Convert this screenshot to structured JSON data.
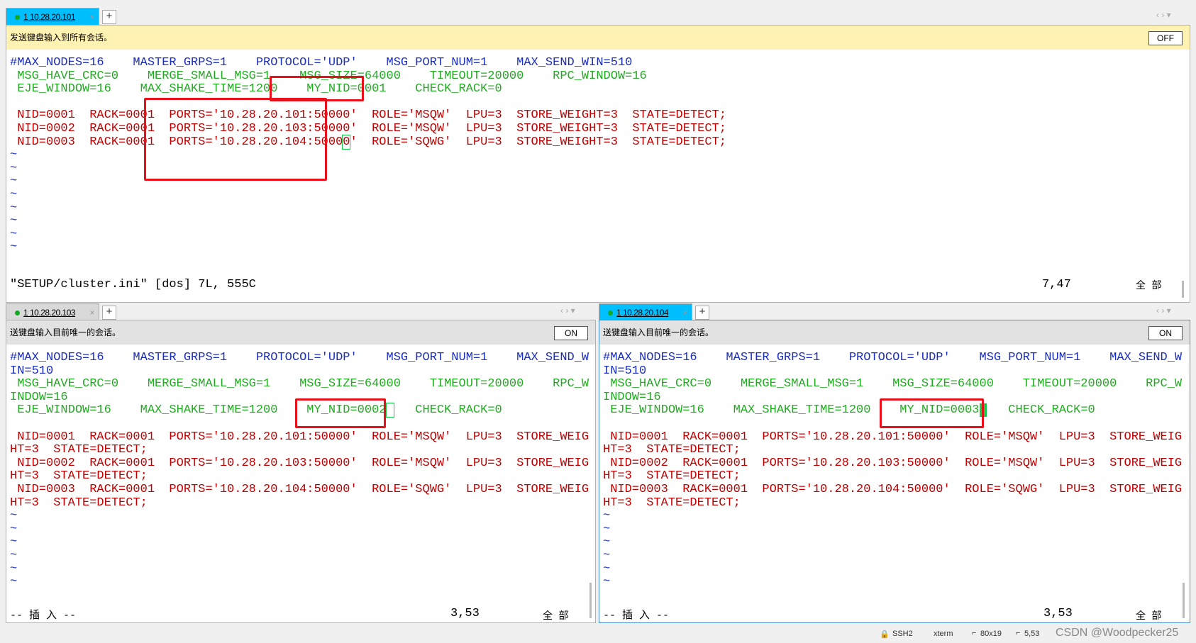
{
  "top": {
    "tab": {
      "label": "1 10.28.20.101"
    },
    "banner": {
      "text": "发送键盘输入到所有会话。",
      "button": "OFF"
    },
    "lines": [
      [
        [
          "b",
          "#MAX_NODES=16    MASTER_GRPS=1    PROTOCOL='UDP'    MSG_PORT_NUM=1    MAX_SEND_WIN=510"
        ]
      ],
      [
        [
          "g",
          " MSG_HAVE_CRC=0    MERGE_SMALL_MSG=1    MSG_SIZE=64000    TIMEOUT=20000    RPC_WINDOW=16"
        ]
      ],
      [
        [
          "g",
          " EJE_WINDOW=16    MAX_SHAKE_TIME=1200    MY_NID=0001    CHECK_RACK=0"
        ]
      ],
      [
        [
          "g",
          ""
        ]
      ],
      [
        [
          "r",
          " NID=0001  RACK=0001  PORTS='10.28.20.101:50000'  ROLE='MSQW'  LPU=3  STORE_WEIGHT=3  STATE=DETECT;"
        ]
      ],
      [
        [
          "r",
          " NID=0002  RACK=0001  PORTS='10.28.20.103:50000'  ROLE='MSQW'  LPU=3  STORE_WEIGHT=3  STATE=DETECT;"
        ]
      ],
      [
        [
          "r",
          " NID=0003  RACK=0001  PORTS='10.28.20.104:5000"
        ],
        [
          "curo",
          "0"
        ],
        [
          "r",
          "'  ROLE='SQWG'  LPU=3  STORE_WEIGHT=3  STATE=DETECT;"
        ]
      ],
      [
        [
          "t",
          "~"
        ]
      ],
      [
        [
          "t",
          "~"
        ]
      ],
      [
        [
          "t",
          "~"
        ]
      ],
      [
        [
          "t",
          "~"
        ]
      ],
      [
        [
          "t",
          "~"
        ]
      ],
      [
        [
          "t",
          "~"
        ]
      ],
      [
        [
          "t",
          "~"
        ]
      ],
      [
        [
          "t",
          "~"
        ]
      ]
    ],
    "status_left": "\"SETUP/cluster.ini\" [dos] 7L, 555C",
    "status_pos": "7,47",
    "status_all": "全 部"
  },
  "left": {
    "tab": {
      "label": "1 10.28.20.103"
    },
    "banner": {
      "text": "送键盘输入目前唯一的会话。",
      "button": "ON"
    },
    "lines": [
      [
        [
          "b",
          "#MAX_NODES=16    MASTER_GRPS=1    PROTOCOL='UDP'    MSG_PORT_NUM=1    MAX_SEND_W"
        ]
      ],
      [
        [
          "b",
          "IN=510"
        ]
      ],
      [
        [
          "g",
          " MSG_HAVE_CRC=0    MERGE_SMALL_MSG=1    MSG_SIZE=64000    TIMEOUT=20000    RPC_W"
        ]
      ],
      [
        [
          "g",
          "INDOW=16"
        ]
      ],
      [
        [
          "g",
          " EJE_WINDOW=16    MAX_SHAKE_TIME=1200    MY_NID=0002"
        ],
        [
          "curo",
          " "
        ],
        [
          "g",
          "   CHECK_RACK=0"
        ]
      ],
      [
        [
          "g",
          ""
        ]
      ],
      [
        [
          "r",
          " NID=0001  RACK=0001  PORTS='10.28.20.101:50000'  ROLE='MSQW'  LPU=3  STORE_WEIG"
        ]
      ],
      [
        [
          "r",
          "HT=3  STATE=DETECT;"
        ]
      ],
      [
        [
          "r",
          " NID=0002  RACK=0001  PORTS='10.28.20.103:50000'  ROLE='MSQW'  LPU=3  STORE_WEIG"
        ]
      ],
      [
        [
          "r",
          "HT=3  STATE=DETECT;"
        ]
      ],
      [
        [
          "r",
          " NID=0003  RACK=0001  PORTS='10.28.20.104:50000'  ROLE='SQWG'  LPU=3  STORE_WEIG"
        ]
      ],
      [
        [
          "r",
          "HT=3  STATE=DETECT;"
        ]
      ],
      [
        [
          "t",
          "~"
        ]
      ],
      [
        [
          "t",
          "~"
        ]
      ],
      [
        [
          "t",
          "~"
        ]
      ],
      [
        [
          "t",
          "~"
        ]
      ],
      [
        [
          "t",
          "~"
        ]
      ],
      [
        [
          "t",
          "~"
        ]
      ]
    ],
    "status_left": "-- 插 入 --",
    "status_pos": "3,53",
    "status_all": "全 部"
  },
  "right": {
    "tab": {
      "label": "1 10.28.20.104"
    },
    "banner": {
      "text": "送键盘输入目前唯一的会话。",
      "button": "ON"
    },
    "lines": [
      [
        [
          "b",
          "#MAX_NODES=16    MASTER_GRPS=1    PROTOCOL='UDP'    MSG_PORT_NUM=1    MAX_SEND_W"
        ]
      ],
      [
        [
          "b",
          "IN=510"
        ]
      ],
      [
        [
          "g",
          " MSG_HAVE_CRC=0    MERGE_SMALL_MSG=1    MSG_SIZE=64000    TIMEOUT=20000    RPC_W"
        ]
      ],
      [
        [
          "g",
          "INDOW=16"
        ]
      ],
      [
        [
          "g",
          " EJE_WINDOW=16    MAX_SHAKE_TIME=1200    MY_NID=0003"
        ],
        [
          "cur",
          " "
        ],
        [
          "g",
          "   CHECK_RACK=0"
        ]
      ],
      [
        [
          "g",
          ""
        ]
      ],
      [
        [
          "r",
          " NID=0001  RACK=0001  PORTS='10.28.20.101:50000'  ROLE='MSQW'  LPU=3  STORE_WEIG"
        ]
      ],
      [
        [
          "r",
          "HT=3  STATE=DETECT;"
        ]
      ],
      [
        [
          "r",
          " NID=0002  RACK=0001  PORTS='10.28.20.103:50000'  ROLE='MSQW'  LPU=3  STORE_WEIG"
        ]
      ],
      [
        [
          "r",
          "HT=3  STATE=DETECT;"
        ]
      ],
      [
        [
          "r",
          " NID=0003  RACK=0001  PORTS='10.28.20.104:50000'  ROLE='SQWG'  LPU=3  STORE_WEIG"
        ]
      ],
      [
        [
          "r",
          "HT=3  STATE=DETECT;"
        ]
      ],
      [
        [
          "t",
          "~"
        ]
      ],
      [
        [
          "t",
          "~"
        ]
      ],
      [
        [
          "t",
          "~"
        ]
      ],
      [
        [
          "t",
          "~"
        ]
      ],
      [
        [
          "t",
          "~"
        ]
      ],
      [
        [
          "t",
          "~"
        ]
      ]
    ],
    "status_left": "-- 插 入 --",
    "status_pos": "3,53",
    "status_all": "全 部"
  },
  "statusbar": {
    "protocol": "SSH2",
    "terminal": "xterm",
    "size": "80x19",
    "cursor": "5,53",
    "watermark": "CSDN @Woodpecker25"
  },
  "colors": {
    "highlight": "#e8101a",
    "active_tab": "#00bfff",
    "sync_banner": "#fff2b3"
  }
}
